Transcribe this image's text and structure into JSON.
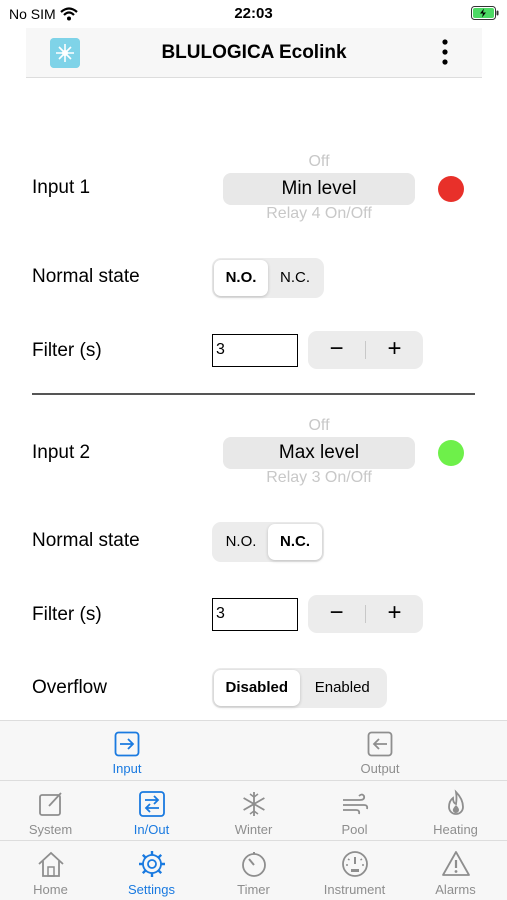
{
  "status_bar": {
    "carrier": "No SIM",
    "time": "22:03"
  },
  "header": {
    "title": "BLULOGICA Ecolink"
  },
  "input1": {
    "label": "Input 1",
    "picker_above": "Off",
    "picker_selected": "Min level",
    "picker_below": "Relay 4 On/Off",
    "indicator_color": "#e8302a",
    "normal_state_label": "Normal state",
    "normal_state_options": [
      "N.O.",
      "N.C."
    ],
    "normal_state_selected": "N.O.",
    "filter_label": "Filter (s)",
    "filter_value": "3",
    "stepper_minus": "−",
    "stepper_plus": "+"
  },
  "input2": {
    "label": "Input 2",
    "picker_above": "Off",
    "picker_selected": "Max level",
    "picker_below": "Relay 3 On/Off",
    "indicator_color": "#6ef04a",
    "normal_state_label": "Normal state",
    "normal_state_options": [
      "N.O.",
      "N.C."
    ],
    "normal_state_selected": "N.C.",
    "filter_label": "Filter (s)",
    "filter_value": "3",
    "stepper_minus": "−",
    "stepper_plus": "+",
    "overflow_label": "Overflow",
    "overflow_options": [
      "Disabled",
      "Enabled"
    ],
    "overflow_selected": "Disabled"
  },
  "sub_tabs": [
    {
      "label": "Input",
      "icon": "arrow-right-box-icon",
      "active": true
    },
    {
      "label": "Output",
      "icon": "arrow-left-box-icon",
      "active": false
    }
  ],
  "section_tabs": [
    {
      "label": "System",
      "icon": "pencil-square-icon",
      "active": false
    },
    {
      "label": "In/Out",
      "icon": "arrows-swap-icon",
      "active": true
    },
    {
      "label": "Winter",
      "icon": "snowflake-icon",
      "active": false
    },
    {
      "label": "Pool",
      "icon": "wind-icon",
      "active": false
    },
    {
      "label": "Heating",
      "icon": "flame-icon",
      "active": false
    }
  ],
  "main_tabs": [
    {
      "label": "Home",
      "icon": "house-icon",
      "active": false
    },
    {
      "label": "Settings",
      "icon": "gear-icon",
      "active": true
    },
    {
      "label": "Timer",
      "icon": "timer-icon",
      "active": false
    },
    {
      "label": "Instrument",
      "icon": "gauge-icon",
      "active": false
    },
    {
      "label": "Alarms",
      "icon": "warning-icon",
      "active": false
    }
  ],
  "colors": {
    "accent": "#1a7ae0",
    "inactive": "#8e8e8e"
  }
}
